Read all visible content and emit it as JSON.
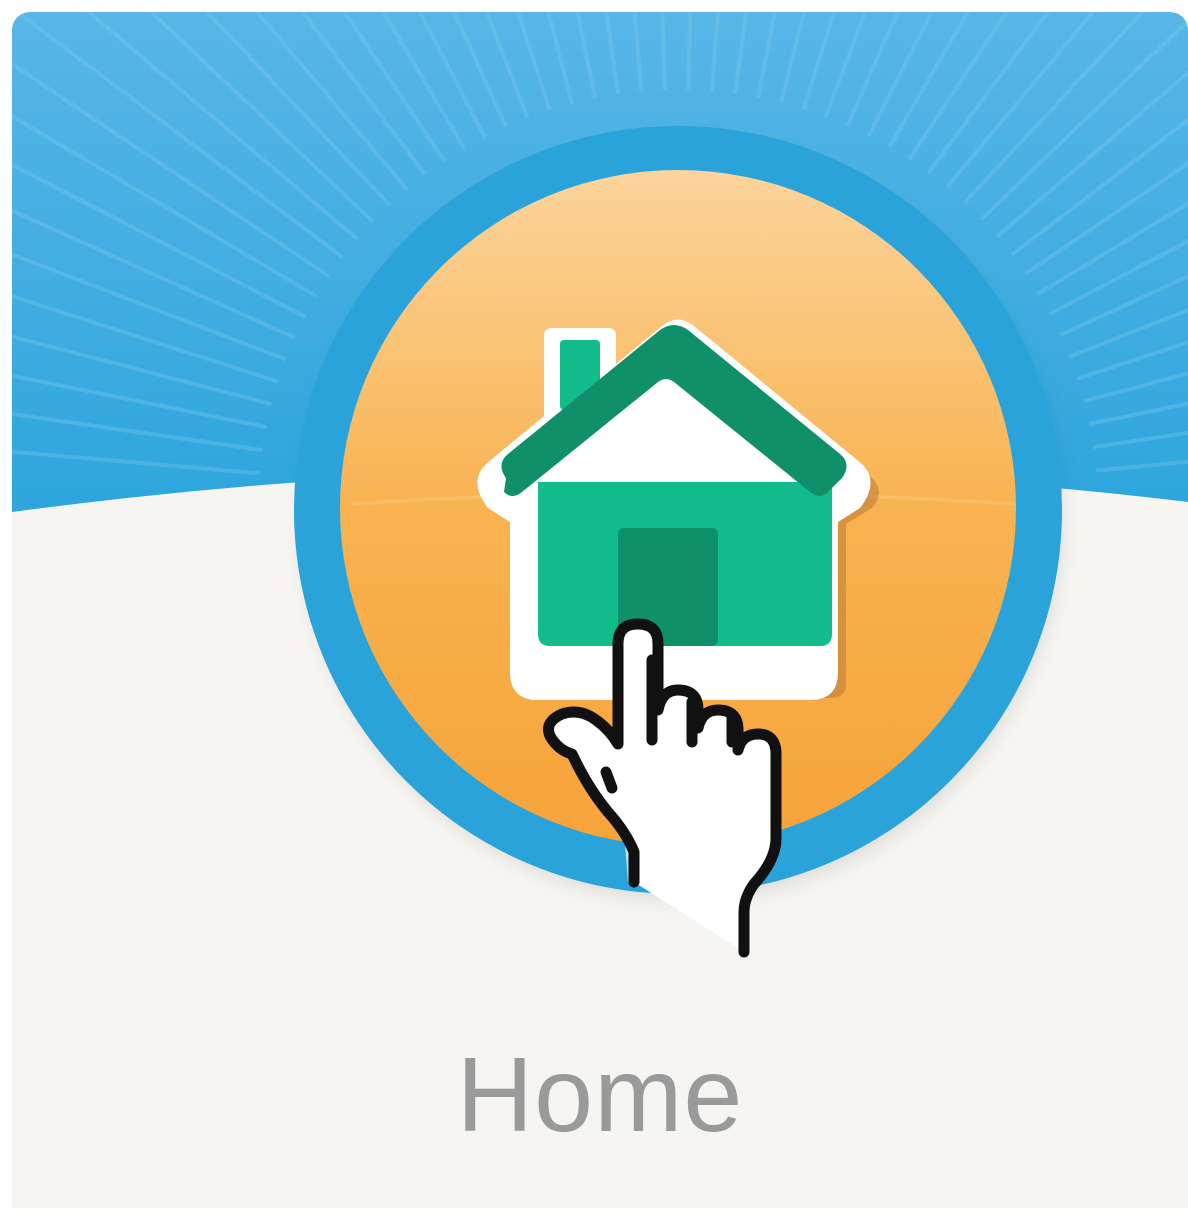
{
  "tile": {
    "label": "Home",
    "icon": "house-icon",
    "pointer": "pointing-hand-cursor-icon",
    "colors": {
      "sky": "#2ca4dc",
      "sky_light": "#56b4e4",
      "ground": "#f6f5f1",
      "button_ring": "#2ba3d9",
      "button_top": "#fbd59c",
      "button_bottom": "#f7a53c",
      "house_body": "#12bd8b",
      "house_roof": "#0f9068",
      "house_door": "#0f9068",
      "label": "#9a9a9a"
    }
  }
}
